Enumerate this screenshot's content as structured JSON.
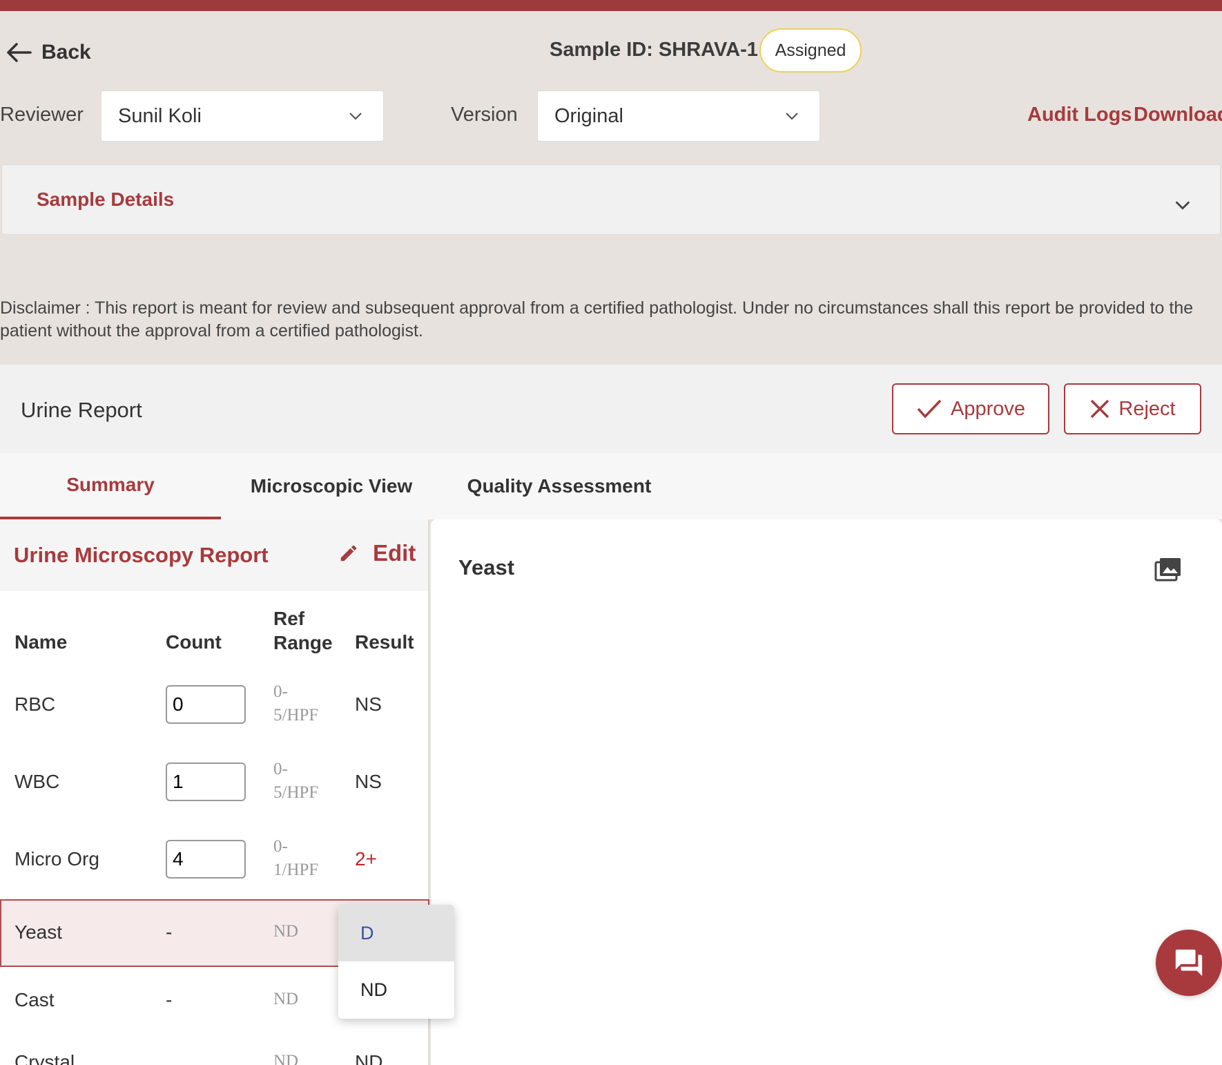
{
  "header": {
    "back_label": "Back",
    "sample_id": "Sample ID: SHRAVA-1",
    "status": "Assigned"
  },
  "filters": {
    "reviewer_label": "Reviewer",
    "reviewer_value": "Sunil Koli",
    "version_label": "Version",
    "version_value": "Original",
    "audit_logs": "Audit Logs",
    "download": "Download"
  },
  "sample_details": {
    "title": "Sample Details"
  },
  "disclaimer": "Disclaimer :  This report is meant for review and subsequent approval from a certified pathologist. Under no circumstances shall this report be provided to the patient without the approval from a certified pathologist.",
  "report": {
    "title": "Urine Report",
    "approve_label": "Approve",
    "reject_label": "Reject"
  },
  "tabs": [
    {
      "label": "Summary",
      "active": true
    },
    {
      "label": "Microscopic View",
      "active": false
    },
    {
      "label": "Quality Assessment",
      "active": false
    }
  ],
  "microscopy": {
    "title": "Urine Microscopy Report",
    "edit_label": "Edit",
    "columns": {
      "name": "Name",
      "count": "Count",
      "ref_line1": "Ref",
      "ref_line2": "Range",
      "result": "Result"
    },
    "rows": [
      {
        "name": "RBC",
        "count": "0",
        "ref_line1": "0-",
        "ref_line2": "5/HPF",
        "result": "NS"
      },
      {
        "name": "WBC",
        "count": "1",
        "ref_line1": "0-",
        "ref_line2": "5/HPF",
        "result": "NS"
      },
      {
        "name": "Micro Org",
        "count": "4",
        "ref_line1": "0-",
        "ref_line2": "1/HPF",
        "result": "2+"
      },
      {
        "name": "Yeast",
        "count": "-",
        "ref": "ND"
      },
      {
        "name": "Cast",
        "count": "-",
        "ref": "ND"
      },
      {
        "name": "Crystal",
        "ref": "ND",
        "result": "ND"
      }
    ]
  },
  "detail_panel": {
    "title": "Yeast",
    "icon": "image-gallery-icon"
  },
  "result_dropdown": {
    "options": [
      "D",
      "ND"
    ],
    "highlighted": "D"
  },
  "colors": {
    "brand": "#9c3a3d",
    "accent_red": "#a83a3d",
    "badge_border": "#f0cf5a",
    "background": "#e7e2dd"
  }
}
